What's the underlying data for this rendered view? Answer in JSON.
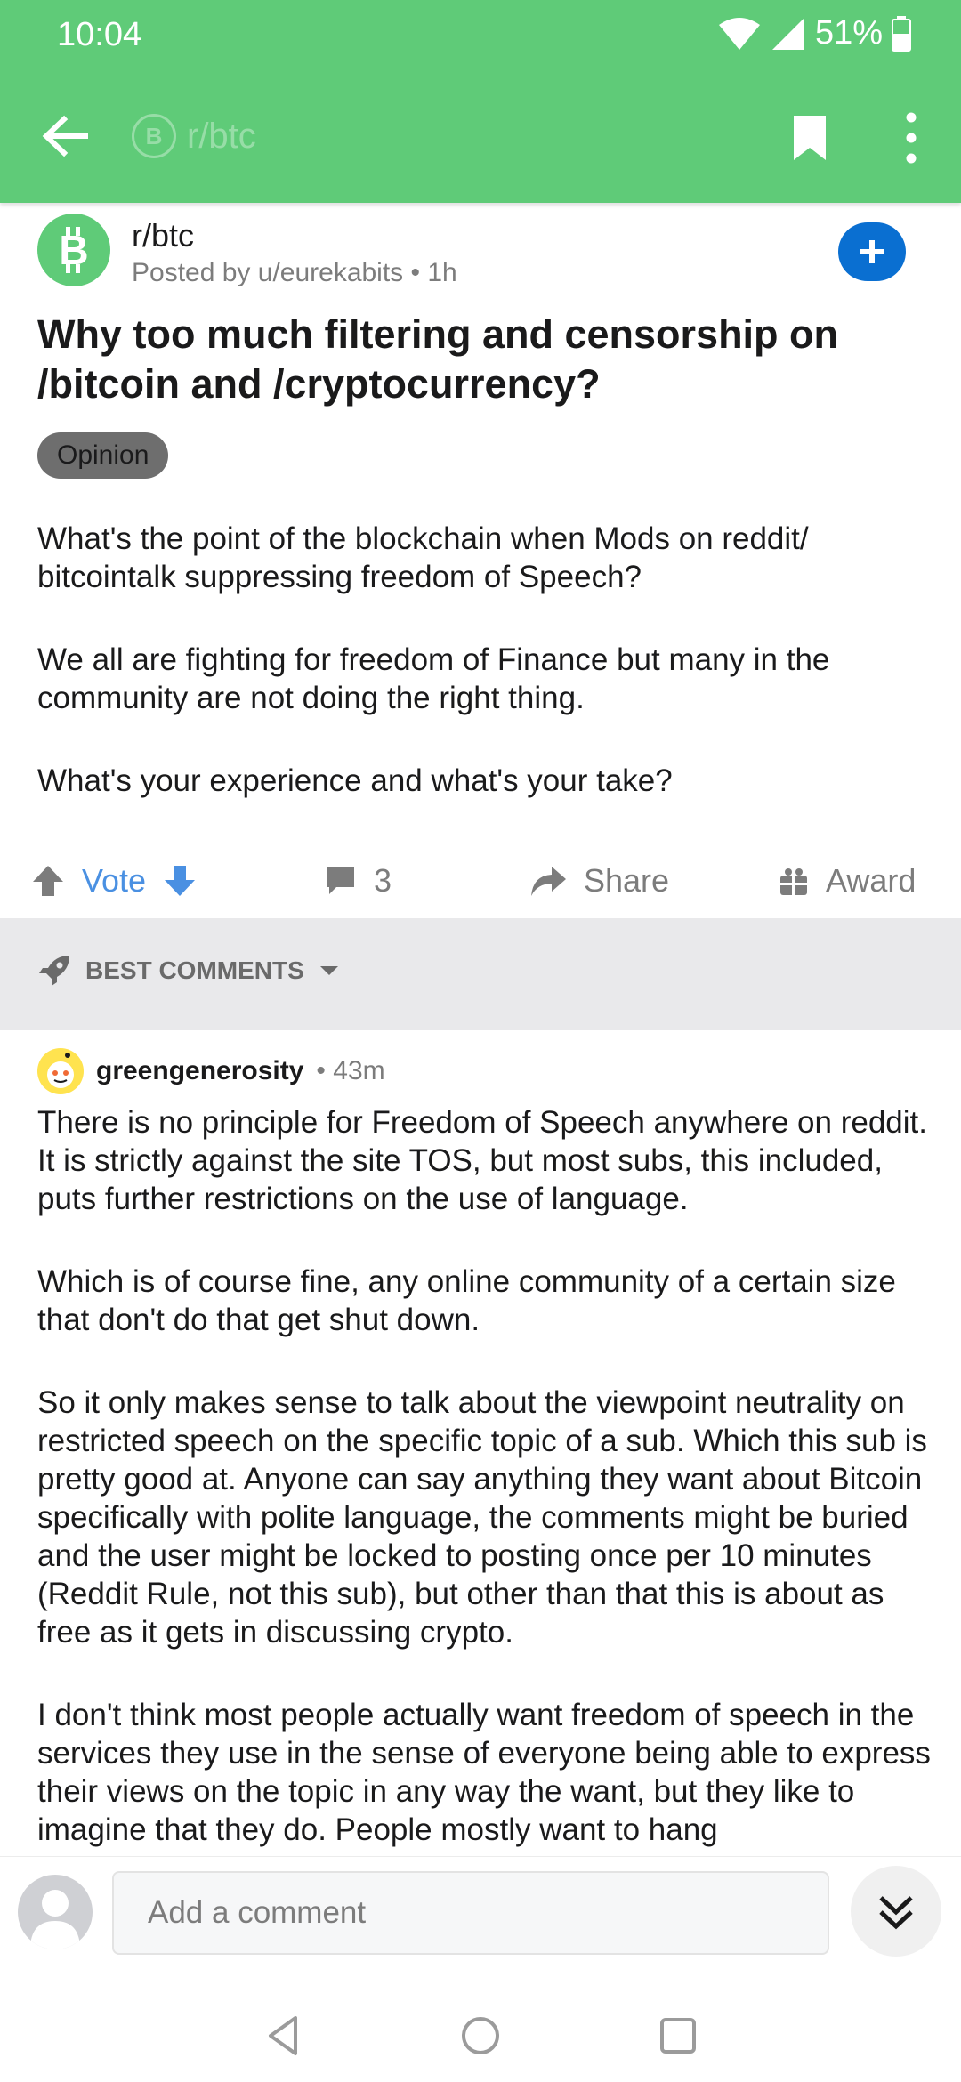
{
  "status_bar": {
    "time": "10:04",
    "battery": "51%"
  },
  "app_bar": {
    "subreddit_ghost": "r/btc"
  },
  "post": {
    "subreddit": "r/btc",
    "posted_by": "Posted by u/eurekabits • 1h",
    "title": "Why too much filtering and censorship on /bitcoin and /cryptocurrency?",
    "flair": "Opinion",
    "body": [
      "What's the point of the blockchain when Mods on reddit/ bitcointalk suppressing freedom of Speech?",
      "We all are fighting for freedom of Finance but many in the community are not doing the right thing.",
      "What's your experience and what's your take?"
    ]
  },
  "actions": {
    "vote_label": "Vote",
    "comment_count": "3",
    "share_label": "Share",
    "award_label": "Award"
  },
  "sort": {
    "label": "BEST COMMENTS"
  },
  "comment": {
    "author": "greengenerosity",
    "time": "• 43m",
    "paragraphs": [
      "There is no principle for Freedom of Speech anywhere on reddit. It is strictly against the site TOS, but most subs, this included, puts further restrictions on the use of language.",
      "Which is of course fine, any online community of a certain size that don't do that get shut down.",
      "So it only makes sense to talk about the viewpoint neutrality on restricted speech on the specific topic of a sub. Which this sub is pretty good at. Anyone can say anything they want about Bitcoin specifically with polite language, the comments might be buried and the user might be locked to posting once per 10 minutes (Reddit Rule, not this sub), but other than that this is about as free as it gets in discussing crypto.",
      "I don't think most people actually want freedom of speech in the services they use in the sense of everyone being able to express their views on the topic in any way the want, but they like to imagine that they do. People mostly want to hang"
    ]
  },
  "composer": {
    "placeholder": "Add a comment"
  },
  "colors": {
    "app_bar": "#5fcb78",
    "accent": "#4a90e2",
    "join": "#0a6fd1"
  },
  "icons": [
    "back-arrow-icon",
    "bookmark-icon",
    "more-vert-icon",
    "bitcoin-icon",
    "plus-icon",
    "upvote-icon",
    "downvote-icon",
    "comment-icon",
    "share-icon",
    "award-icon",
    "rocket-icon",
    "chevron-down-icon",
    "user-avatar-icon",
    "double-chevron-down-icon"
  ]
}
